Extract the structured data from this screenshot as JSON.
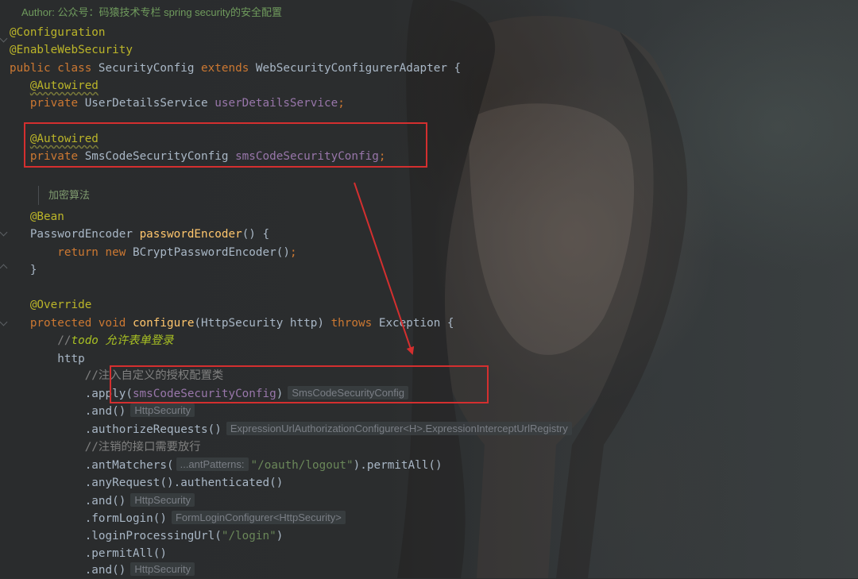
{
  "header_comment": "Author: 公众号：码猿技术专栏 spring security的安全配置",
  "code": {
    "ann_configuration": "@Configuration",
    "ann_enable_web_security": "@EnableWebSecurity",
    "class_decl": {
      "public": "public",
      "class": "class",
      "name": "SecurityConfig",
      "extends": "extends",
      "parent": "WebSecurityConfigurerAdapter {"
    },
    "field1": {
      "annotation": "@Autowired",
      "private": "private",
      "type": "UserDetailsService",
      "name": "userDetailsService",
      "semicolon": ";"
    },
    "field2": {
      "annotation": "@Autowired",
      "private": "private",
      "type": "SmsCodeSecurityConfig",
      "name": "smsCodeSecurityConfig",
      "semicolon": ";"
    },
    "doc_comment": "加密算法",
    "bean_method": {
      "annotation": "@Bean",
      "return_type": "PasswordEncoder",
      "name": "passwordEncoder",
      "params": "() {",
      "return_kw": "return",
      "new_kw": "new",
      "return_expr": "BCryptPasswordEncoder()",
      "semicolon": ";",
      "close": "}"
    },
    "configure_method": {
      "annotation": "@Override",
      "protected": "protected",
      "void": "void",
      "name": "configure",
      "params": "(HttpSecurity http)",
      "throws": "throws",
      "exception": "Exception {",
      "todo_prefix": "//",
      "todo_kw": "todo",
      "todo_text": " 允许表单登录",
      "http": "http"
    },
    "chain": {
      "comment_custom": "//注入自定义的授权配置类",
      "apply_prefix": ".apply(",
      "apply_arg": "smsCodeSecurityConfig",
      "apply_suffix": ")",
      "apply_hint": "SmsCodeSecurityConfig",
      "and1": ".and()",
      "and1_hint": "HttpSecurity",
      "authorize": ".authorizeRequests()",
      "authorize_hint": "ExpressionUrlAuthorizationConfigurer<H>.ExpressionInterceptUrlRegistry",
      "comment_logout": "//注销的接口需要放行",
      "ant_prefix": ".antMatchers(",
      "ant_param_hint": "...antPatterns:",
      "ant_string": "\"/oauth/logout\"",
      "ant_suffix": ").permitAll()",
      "any_request": ".anyRequest().authenticated()",
      "and2": ".and()",
      "and2_hint": "HttpSecurity",
      "form_login": ".formLogin()",
      "form_login_hint": "FormLoginConfigurer<HttpSecurity>",
      "login_prefix": ".loginProcessingUrl(",
      "login_string": "\"/login\"",
      "login_suffix": ")",
      "permit_all": ".permitAll()",
      "and3": ".and()",
      "and3_hint": "HttpSecurity"
    }
  },
  "colors": {
    "keyword": "#cc7832",
    "annotation": "#bbb529",
    "field": "#9876aa",
    "method": "#ffc66d",
    "string": "#6a8759",
    "comment": "#808080",
    "default_text": "#a9b7c6",
    "highlight_box": "#d42f2f"
  }
}
